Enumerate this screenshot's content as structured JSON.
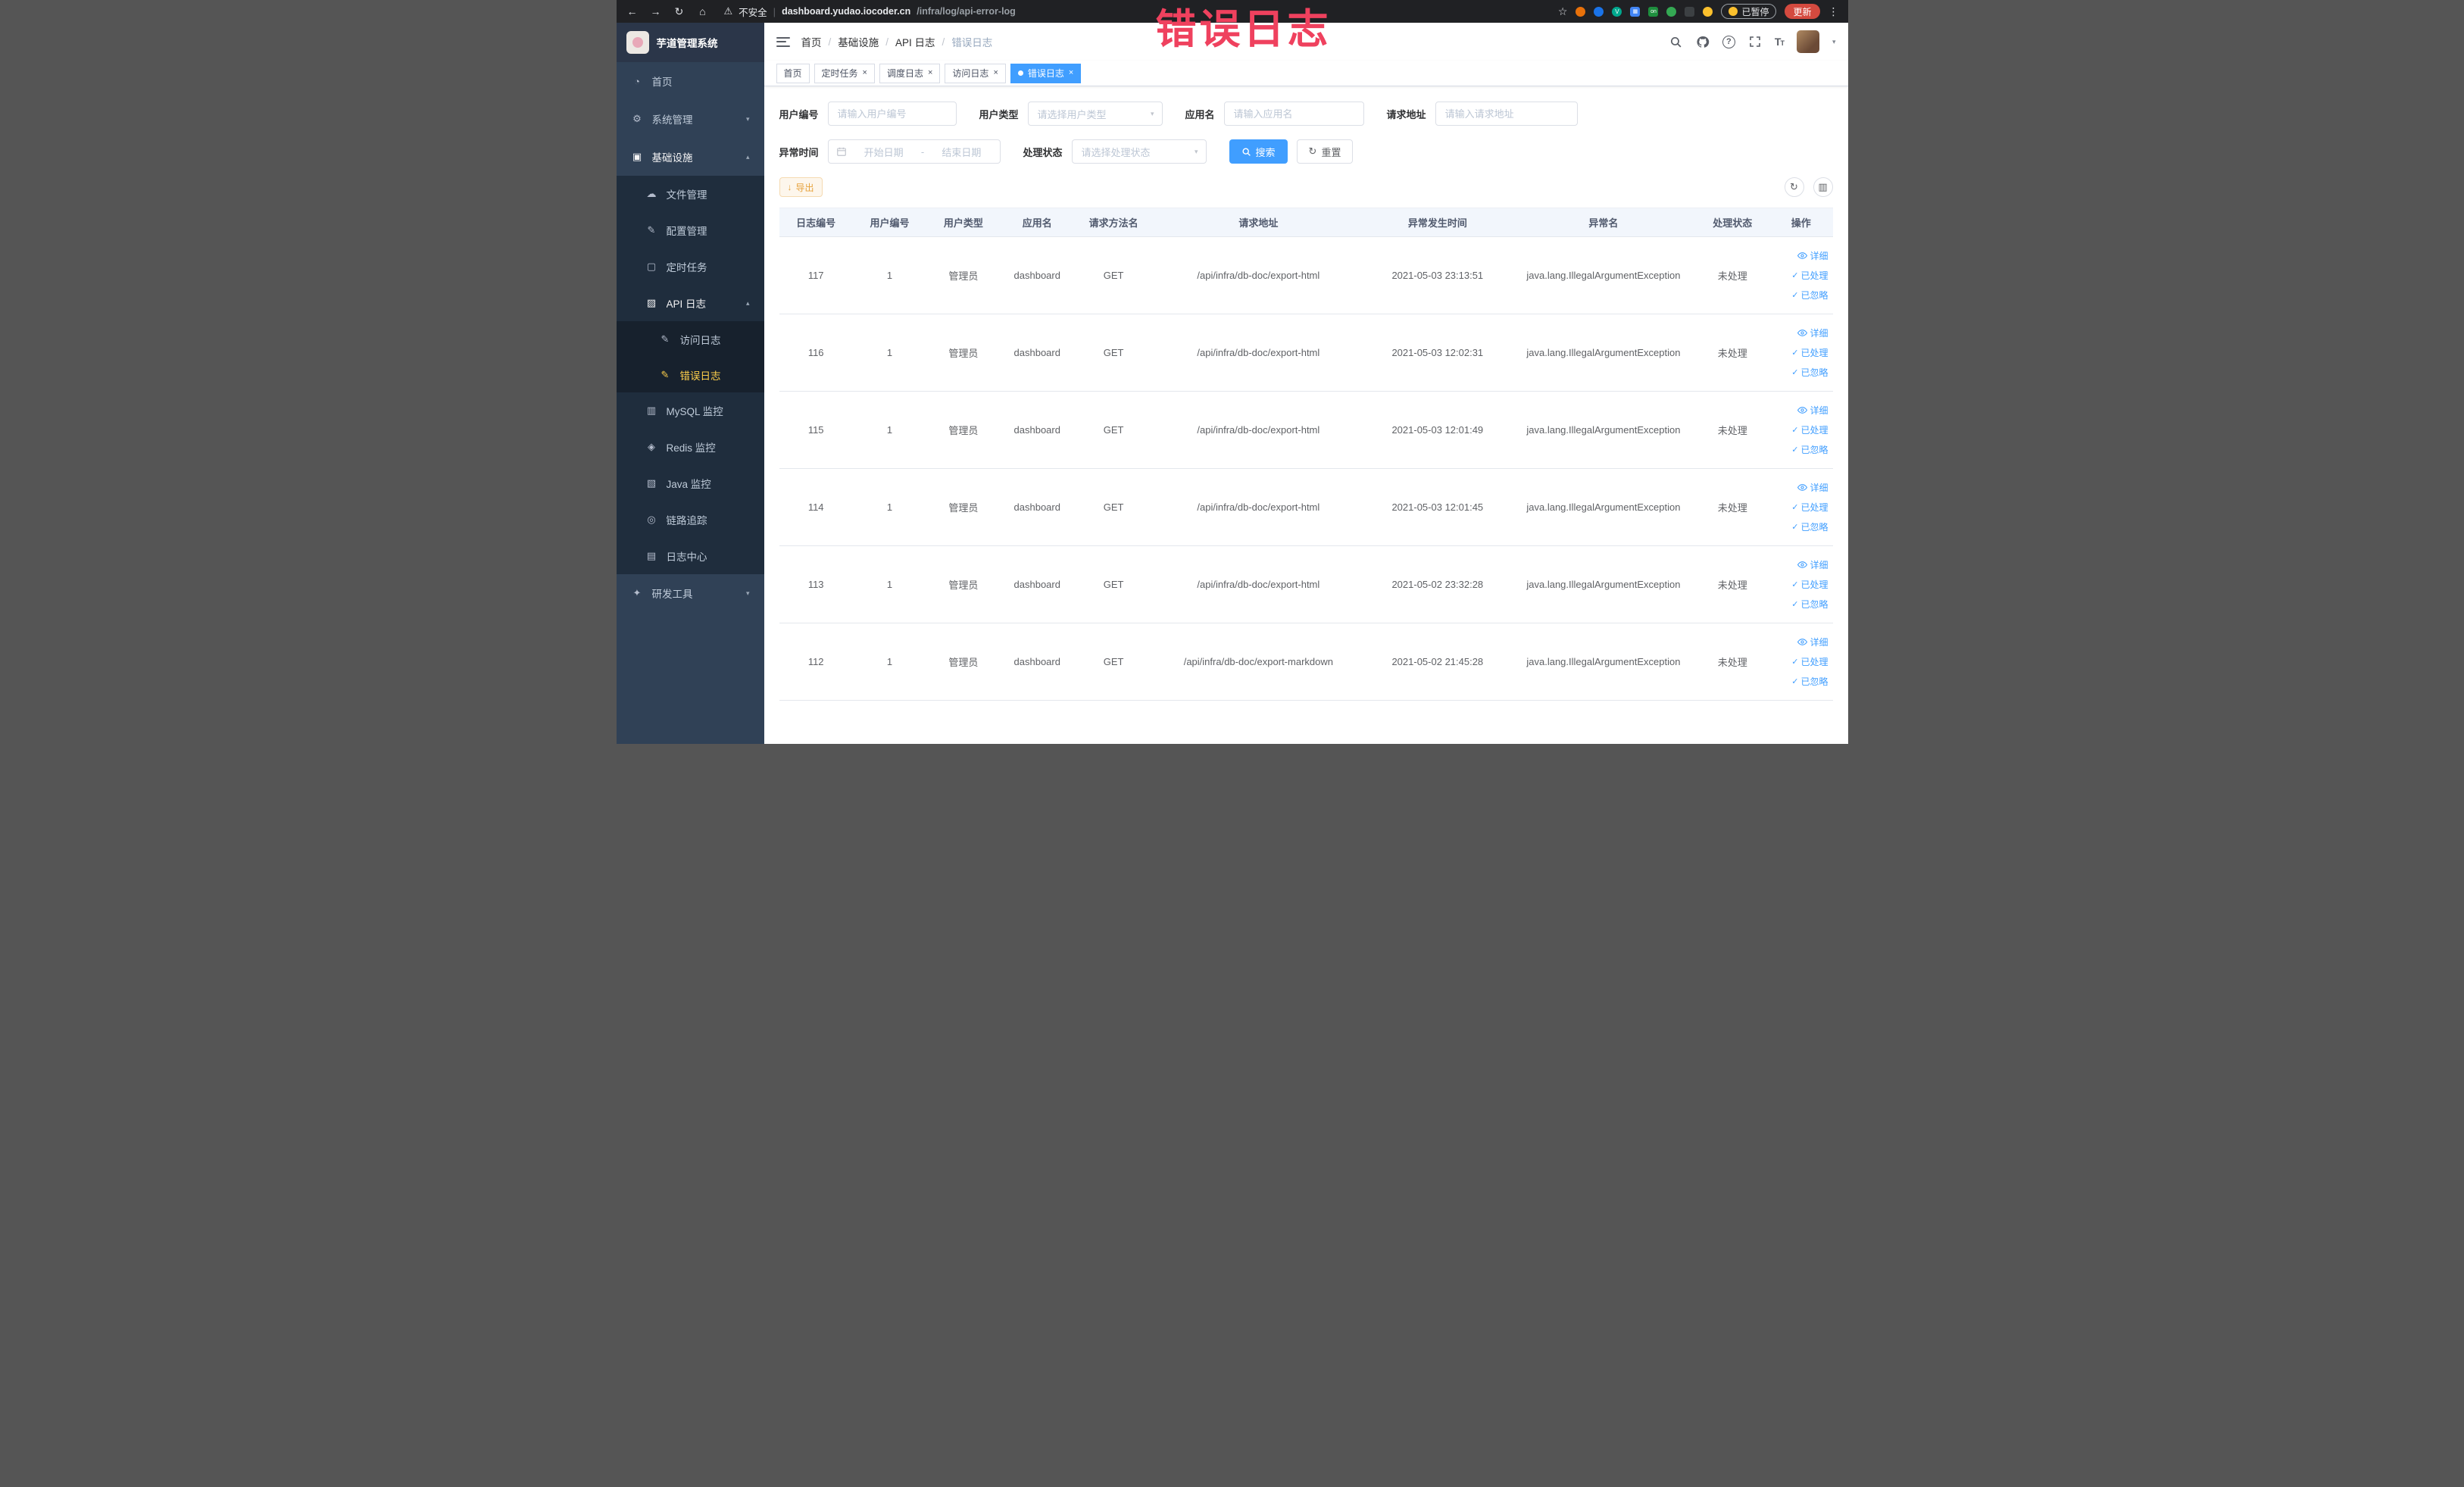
{
  "browser": {
    "security_label": "不安全",
    "url_host": "dashboard.yudao.iocoder.cn",
    "url_path": "/infra/log/api-error-log",
    "paused_badge": "已暂停",
    "update_button": "更新",
    "extension_badge_on": "on"
  },
  "annotation_text": "错误日志",
  "sidebar": {
    "logo_title": "芋道管理系统",
    "home": "首页",
    "system_mgmt": "系统管理",
    "infrastructure": "基础设施",
    "file_mgmt": "文件管理",
    "config_mgmt": "配置管理",
    "scheduled_jobs": "定时任务",
    "api_logs": "API 日志",
    "access_log": "访问日志",
    "error_log": "错误日志",
    "mysql_monitor": "MySQL 监控",
    "redis_monitor": "Redis 监控",
    "java_monitor": "Java 监控",
    "trace": "链路追踪",
    "log_center": "日志中心",
    "dev_tools": "研发工具"
  },
  "header": {
    "breadcrumb": {
      "home": "首页",
      "infrastructure": "基础设施",
      "api_logs": "API 日志",
      "error_log": "错误日志"
    }
  },
  "tabs": [
    {
      "label": "首页"
    },
    {
      "label": "定时任务"
    },
    {
      "label": "调度日志"
    },
    {
      "label": "访问日志"
    },
    {
      "label": "错误日志"
    }
  ],
  "filters": {
    "user_id_label": "用户编号",
    "user_id_placeholder": "请输入用户编号",
    "user_type_label": "用户类型",
    "user_type_placeholder": "请选择用户类型",
    "app_name_label": "应用名",
    "app_name_placeholder": "请输入应用名",
    "request_url_label": "请求地址",
    "request_url_placeholder": "请输入请求地址",
    "exception_time_label": "异常时间",
    "start_date_placeholder": "开始日期",
    "end_date_placeholder": "结束日期",
    "process_status_label": "处理状态",
    "process_status_placeholder": "请选择处理状态",
    "search_button": "搜索",
    "reset_button": "重置"
  },
  "toolbar": {
    "export_button": "导出"
  },
  "table": {
    "headers": [
      "日志编号",
      "用户编号",
      "用户类型",
      "应用名",
      "请求方法名",
      "请求地址",
      "异常发生时间",
      "异常名",
      "处理状态",
      "操作"
    ],
    "actions": {
      "detail": "详细",
      "processed": "已处理",
      "ignored": "已忽略"
    },
    "rows": [
      {
        "log_id": "117",
        "user_id": "1",
        "user_type": "管理员",
        "app_name": "dashboard",
        "method": "GET",
        "request_url": "/api/infra/db-doc/export-html",
        "exception_time": "2021-05-03 23:13:51",
        "exception_name": "java.lang.IllegalArgumentException",
        "status": "未处理"
      },
      {
        "log_id": "116",
        "user_id": "1",
        "user_type": "管理员",
        "app_name": "dashboard",
        "method": "GET",
        "request_url": "/api/infra/db-doc/export-html",
        "exception_time": "2021-05-03 12:02:31",
        "exception_name": "java.lang.IllegalArgumentException",
        "status": "未处理"
      },
      {
        "log_id": "115",
        "user_id": "1",
        "user_type": "管理员",
        "app_name": "dashboard",
        "method": "GET",
        "request_url": "/api/infra/db-doc/export-html",
        "exception_time": "2021-05-03 12:01:49",
        "exception_name": "java.lang.IllegalArgumentException",
        "status": "未处理"
      },
      {
        "log_id": "114",
        "user_id": "1",
        "user_type": "管理员",
        "app_name": "dashboard",
        "method": "GET",
        "request_url": "/api/infra/db-doc/export-html",
        "exception_time": "2021-05-03 12:01:45",
        "exception_name": "java.lang.IllegalArgumentException",
        "status": "未处理"
      },
      {
        "log_id": "113",
        "user_id": "1",
        "user_type": "管理员",
        "app_name": "dashboard",
        "method": "GET",
        "request_url": "/api/infra/db-doc/export-html",
        "exception_time": "2021-05-02 23:32:28",
        "exception_name": "java.lang.IllegalArgumentException",
        "status": "未处理"
      },
      {
        "log_id": "112",
        "user_id": "1",
        "user_type": "管理员",
        "app_name": "dashboard",
        "method": "GET",
        "request_url": "/api/infra/db-doc/export-markdown",
        "exception_time": "2021-05-02 21:45:28",
        "exception_name": "java.lang.IllegalArgumentException",
        "status": "未处理"
      }
    ]
  }
}
